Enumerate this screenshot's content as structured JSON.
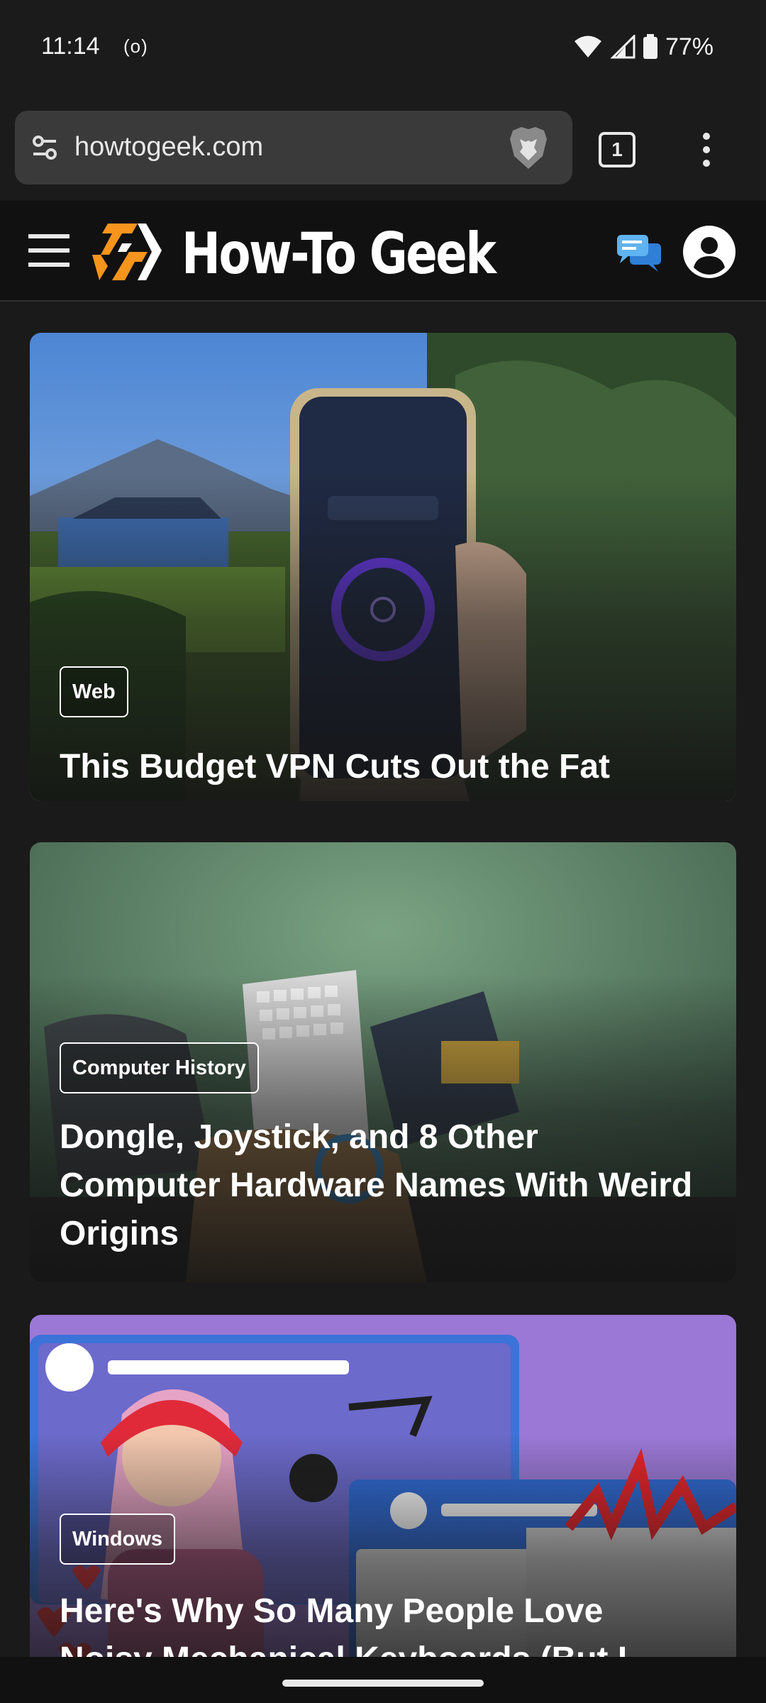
{
  "status_bar": {
    "time": "11:14",
    "radio_indicator": "(o)",
    "battery": "77%",
    "icons": [
      "wifi-icon",
      "signal-icon",
      "battery-icon"
    ]
  },
  "browser": {
    "url": "howtogeek.com",
    "tab_count": "1",
    "icons": [
      "tune-icon",
      "brave-shield-icon",
      "more-vert-icon"
    ]
  },
  "site_header": {
    "title": "How-To Geek",
    "icons": [
      "menu-icon",
      "htg-logo-icon",
      "chat-icon",
      "account-icon"
    ],
    "colors": {
      "logo_orange": "#f7941d",
      "chat_blue": "#3d9ae8"
    }
  },
  "articles": [
    {
      "category": "Web",
      "title": "This Budget VPN Cuts Out the Fat"
    },
    {
      "category": "Computer History",
      "title": "Dongle, Joystick, and 8 Other Computer Hardware Names With Weird Origins"
    },
    {
      "category": "Windows",
      "title": "Here's Why So Many People Love Noisy Mechanical Keyboards (But I"
    }
  ]
}
